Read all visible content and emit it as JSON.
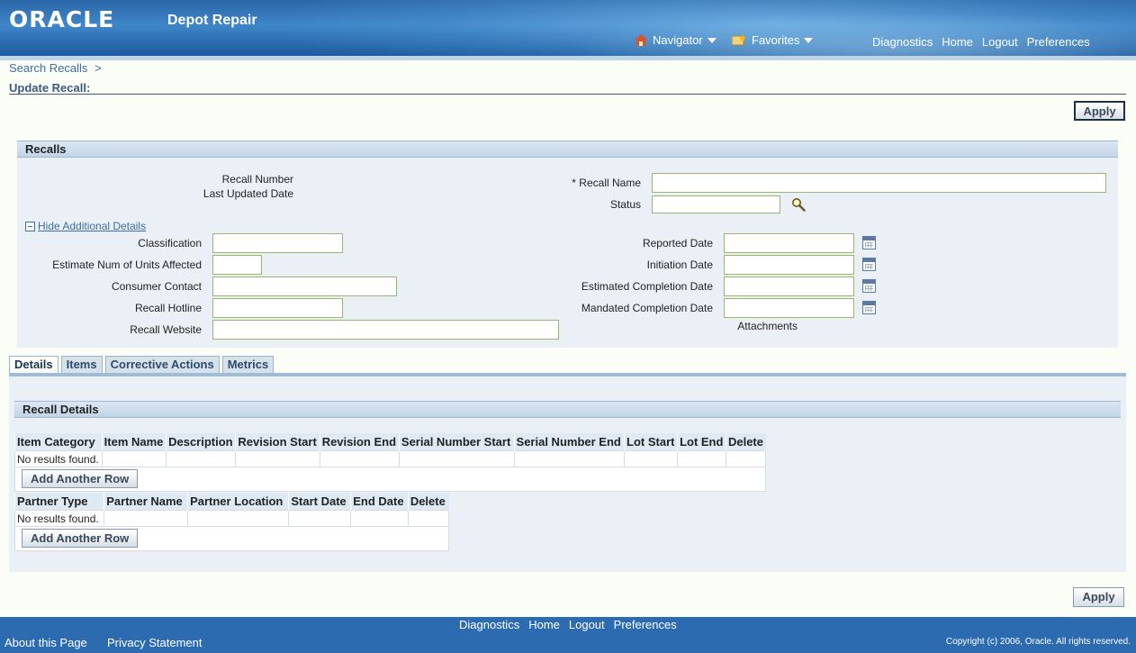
{
  "header": {
    "logo": "ORACLE",
    "app_name": "Depot Repair",
    "navigator_label": "Navigator",
    "favorites_label": "Favorites",
    "global_links": [
      "Diagnostics",
      "Home",
      "Logout",
      "Preferences"
    ]
  },
  "breadcrumb": {
    "link": "Search Recalls",
    "sep": ">"
  },
  "page_title": "Update Recall:",
  "apply_label": "Apply",
  "recalls": {
    "title": "Recalls",
    "recall_number_label": "Recall Number",
    "last_updated_label": "Last Updated Date",
    "recall_name_label": "* Recall Name",
    "recall_name_value": "",
    "status_label": "Status",
    "status_value": "",
    "hide_details_label": "Hide Additional Details",
    "classification_label": "Classification",
    "estimate_units_label": "Estimate Num of Units Affected",
    "consumer_contact_label": "Consumer Contact",
    "recall_hotline_label": "Recall Hotline",
    "recall_website_label": "Recall Website",
    "reported_date_label": "Reported Date",
    "initiation_date_label": "Initiation Date",
    "est_completion_label": "Estimated Completion Date",
    "mandated_completion_label": "Mandated Completion Date",
    "attachments_label": "Attachments"
  },
  "tabs": [
    "Details",
    "Items",
    "Corrective Actions",
    "Metrics"
  ],
  "recall_details": {
    "title": "Recall Details",
    "items_table": {
      "columns": [
        "Item Category",
        "Item Name",
        "Description",
        "Revision Start",
        "Revision End",
        "Serial Number Start",
        "Serial Number End",
        "Lot Start",
        "Lot End",
        "Delete"
      ],
      "empty_text": "No results found."
    },
    "partners_table": {
      "columns": [
        "Partner Type",
        "Partner Name",
        "Partner Location",
        "Start Date",
        "End Date",
        "Delete"
      ],
      "empty_text": "No results found."
    },
    "add_row_label": "Add Another Row"
  },
  "footer": {
    "links": [
      "Diagnostics",
      "Home",
      "Logout",
      "Preferences"
    ],
    "about": "About this Page",
    "privacy": "Privacy Statement",
    "copyright": "Copyright (c) 2006, Oracle. All rights reserved."
  },
  "colors": {
    "header_blue": "#2d6bb0",
    "link_blue": "#3f6ea0",
    "field_border": "#9cb56d"
  }
}
